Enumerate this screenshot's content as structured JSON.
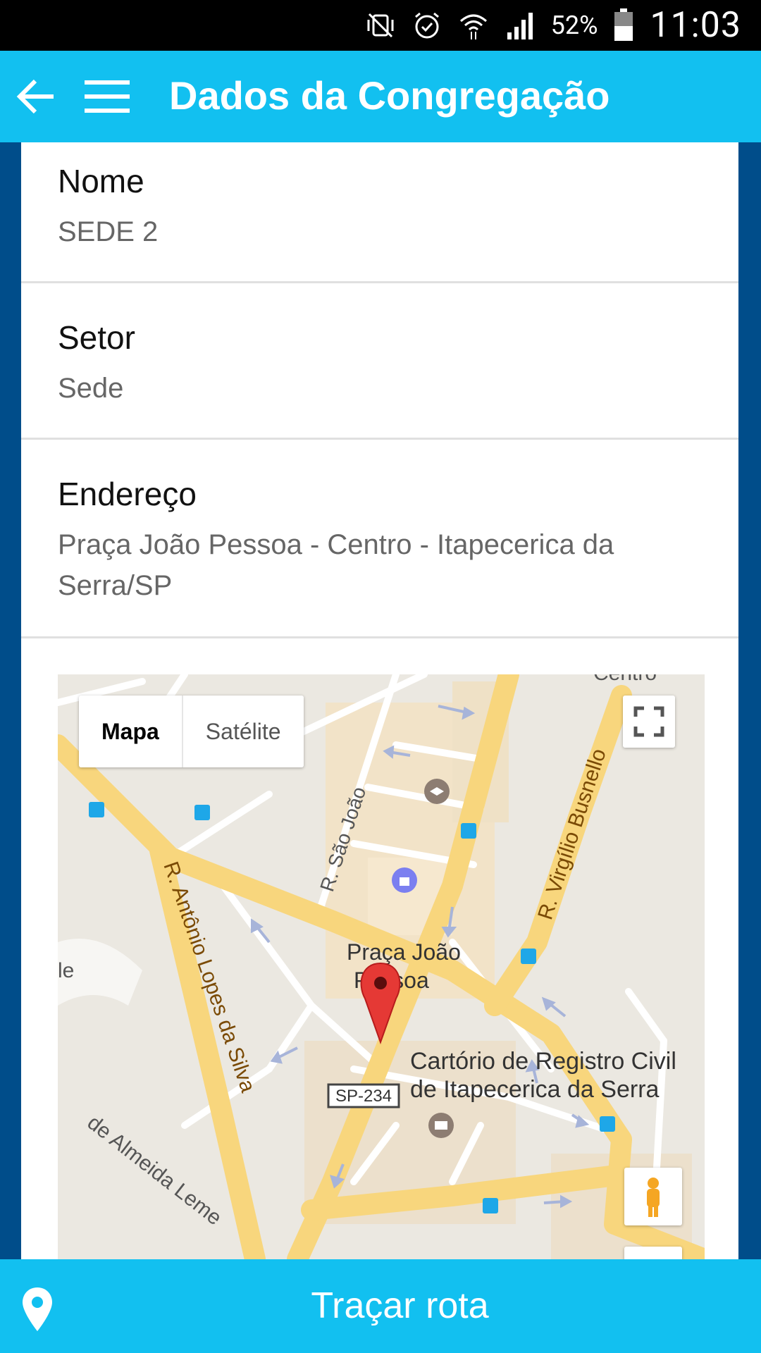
{
  "status_bar": {
    "icons": [
      "mute-vibrate-icon",
      "alarm-icon",
      "wifi-icon",
      "signal-icon",
      "battery-icon"
    ],
    "battery": "52%",
    "time": "11:03"
  },
  "app_bar": {
    "title": "Dados da Congregação",
    "back_icon": "arrow-left-icon",
    "menu_icon": "hamburger-menu-icon"
  },
  "details": [
    {
      "label": "Nome",
      "value": "SEDE 2"
    },
    {
      "label": "Setor",
      "value": "Sede"
    },
    {
      "label": "Endereço",
      "value": "Praça João Pessoa - Centro - Itapecerica da Serra/SP"
    }
  ],
  "map": {
    "type_buttons": {
      "map": "Mapa",
      "satellite": "Satélite",
      "selected": "Mapa"
    },
    "labels": {
      "street_1": "R. Antônio Lopes da Silva",
      "street_2": "R. São João",
      "street_3": "R. Virgílio Busnello",
      "street_4": "de Almeida Leme",
      "place_1": "Praça João",
      "place_2": "Pessoa",
      "place_3": "Cartório de Registro Civil",
      "place_4": "de Itapecerica da Serra",
      "route": "SP-234",
      "edge_top": "Centro",
      "edge_left": "le"
    },
    "icons": [
      "fullscreen-icon",
      "pegman-icon",
      "marker-pin-icon",
      "bus-stop-icon",
      "school-icon",
      "shopping-icon",
      "government-icon"
    ]
  },
  "bottom_bar": {
    "label": "Traçar rota",
    "icon": "location-pin-icon"
  },
  "colors": {
    "primary": "#12c0f0",
    "background": "#004d8a",
    "road": "#f8d67d",
    "marker": "#e53935"
  }
}
